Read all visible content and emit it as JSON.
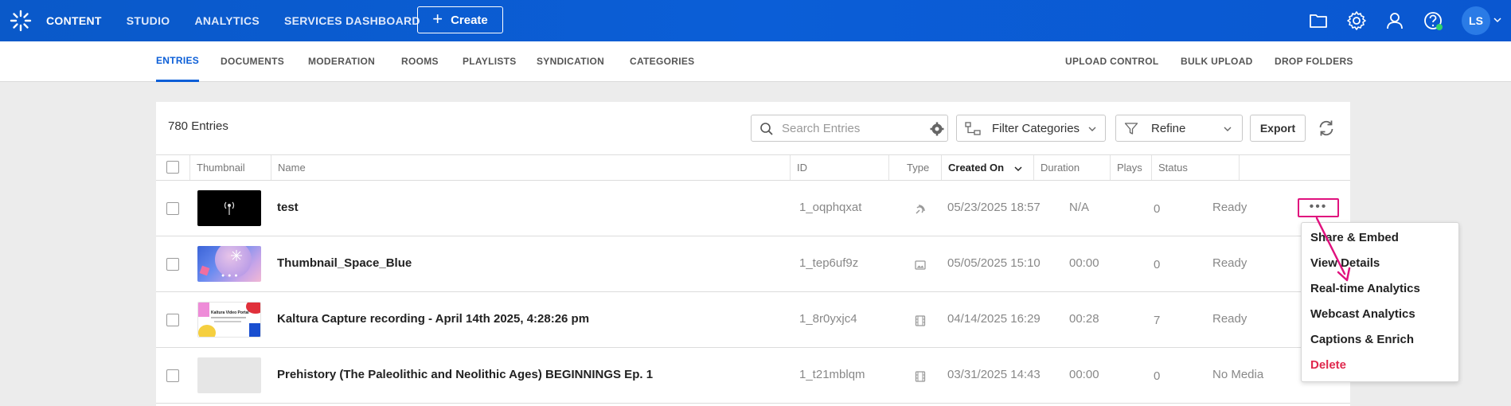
{
  "topbar": {
    "nav": [
      "CONTENT",
      "STUDIO",
      "ANALYTICS",
      "SERVICES DASHBOARD"
    ],
    "create_label": "Create",
    "avatar_initials": "LS",
    "icons": [
      "folder-icon",
      "gear-icon",
      "user-icon",
      "help-icon"
    ]
  },
  "subnav": {
    "left": [
      "ENTRIES",
      "DOCUMENTS",
      "MODERATION",
      "ROOMS",
      "PLAYLISTS",
      "SYNDICATION",
      "CATEGORIES"
    ],
    "right": [
      "UPLOAD CONTROL",
      "BULK UPLOAD",
      "DROP FOLDERS"
    ]
  },
  "toolbar": {
    "entries_count": "780 Entries",
    "search_placeholder": "Search Entries",
    "filter_label": "Filter Categories",
    "refine_label": "Refine",
    "export_label": "Export"
  },
  "table": {
    "columns": [
      "Thumbnail",
      "Name",
      "ID",
      "Type",
      "Created On",
      "Duration",
      "Plays",
      "Status"
    ],
    "rows": [
      {
        "name": "test",
        "id": "1_oqphqxat",
        "type": "live-icon",
        "created": "05/23/2025 18:57",
        "duration": "N/A",
        "plays": "0",
        "status": "Ready"
      },
      {
        "name": "Thumbnail_Space_Blue",
        "id": "1_tep6uf9z",
        "type": "image-icon",
        "created": "05/05/2025 15:10",
        "duration": "00:00",
        "plays": "0",
        "status": "Ready"
      },
      {
        "name": "Kaltura Capture recording - April 14th 2025, 4:28:26 pm",
        "id": "1_8r0yxjc4",
        "type": "video-icon",
        "created": "04/14/2025 16:29",
        "duration": "00:28",
        "plays": "7",
        "status": "Ready"
      },
      {
        "name": "Prehistory (The Paleolithic and Neolithic Ages) BEGINNINGS Ep. 1",
        "id": "1_t21mblqm",
        "type": "video-icon",
        "created": "03/31/2025 14:43",
        "duration": "00:00",
        "plays": "0",
        "status": "No Media"
      }
    ]
  },
  "thumb_text": {
    "capture": "Kaltura Video Portal"
  },
  "action_menu": {
    "items": [
      "Share & Embed",
      "View Details",
      "Real-time Analytics",
      "Webcast Analytics",
      "Captions & Enrich",
      "Delete"
    ]
  },
  "colors": {
    "brand": "#0b5ed7",
    "highlight": "#e0127e",
    "danger": "#e0284d"
  }
}
